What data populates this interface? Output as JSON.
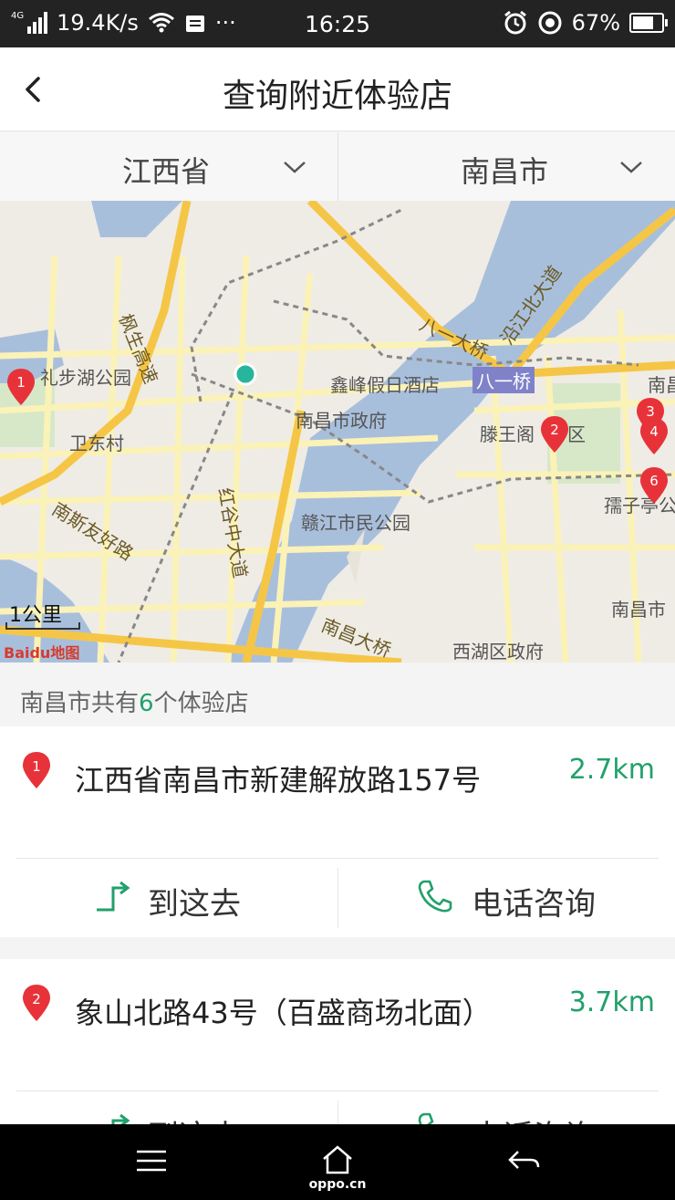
{
  "status_bar": {
    "network": "4G",
    "speed": "19.4K/s",
    "more": "···",
    "time": "16:25",
    "battery": "67%"
  },
  "header": {
    "title": "查询附近体验店"
  },
  "filters": {
    "province": "江西省",
    "city": "南昌市"
  },
  "map": {
    "labels": {
      "lake_park": "礼步湖公园",
      "weidong": "卫东村",
      "nanshi_road": "南斯友好路",
      "fengsheng_highway": "枫生高速",
      "hongguzhong_road": "红谷中大道",
      "ganjiang_park": "赣江市民公园",
      "xinfeng_hotel": "鑫峰假日酒店",
      "nanchang_gov": "南昌市政府",
      "bayi_bridge_label": "八一桥",
      "bayi_bridge_road": "八一大桥",
      "yanjiang_road": "沿江北大道",
      "tengwang": "滕王阁",
      "district_char": "区",
      "ruzi": "孺子亭公",
      "nanchang_hospital": "南昌市",
      "xihu_gov": "西湖区政府",
      "nanchang_bridge": "南昌大桥",
      "nan_edge": "南昌"
    },
    "scale": "1公里",
    "logo": "Baidu地图",
    "markers": [
      "1",
      "2",
      "3",
      "4",
      "6"
    ]
  },
  "summary": {
    "prefix": "南昌市共有",
    "count": "6",
    "suffix": "个体验店"
  },
  "stores": [
    {
      "index": "1",
      "address": "江西省南昌市新建解放路157号",
      "distance": "2.7km",
      "go_label": "到这去",
      "call_label": "电话咨询"
    },
    {
      "index": "2",
      "address": "象山北路43号（百盛商场北面）",
      "distance": "3.7km",
      "go_label": "到这去",
      "call_label": "电话咨询"
    }
  ],
  "nav_bar": {
    "brand": "oppo.cn"
  },
  "colors": {
    "accent": "#22a06b",
    "marker": "#e8323a",
    "river": "#a8bfdc",
    "road_major": "#f5c646",
    "road_minor": "#fbf2b8"
  }
}
